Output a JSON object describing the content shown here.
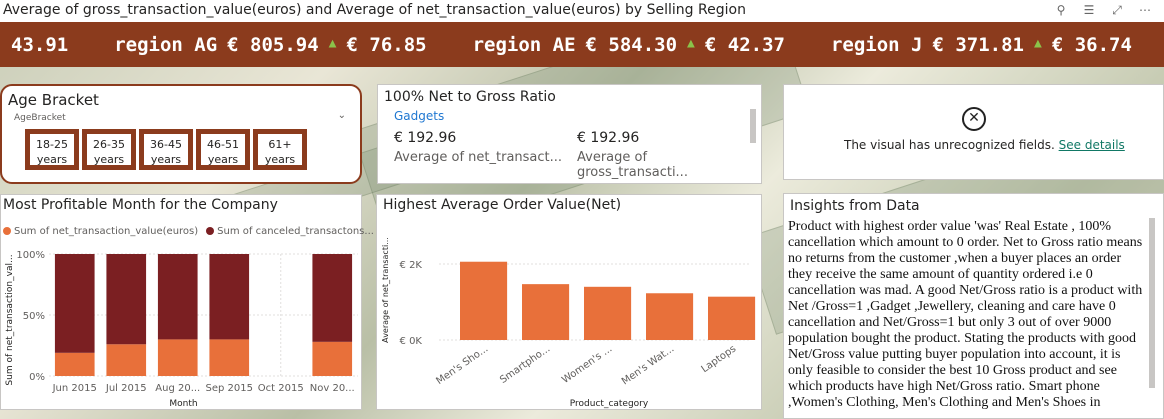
{
  "header": {
    "title": "Average of gross_transaction_value(euros) and Average of net_transaction_value(euros) by Selling Region"
  },
  "ticker": {
    "lead": "43.91",
    "items": [
      {
        "region": "region AG",
        "gross": "€ 805.94",
        "net": "€ 76.85"
      },
      {
        "region": "region AE",
        "gross": "€ 584.30",
        "net": "€ 42.37"
      },
      {
        "region": "region J",
        "gross": "€ 371.81",
        "net": "€ 36.74"
      }
    ],
    "up_color": "#8bc34a"
  },
  "age_slicer": {
    "title": "Age Bracket",
    "field_label": "AgeBracket",
    "options": [
      "18-25 years",
      "26-35 years",
      "36-45 years",
      "46-51 years",
      "61+ years"
    ]
  },
  "ratio_card": {
    "title": "100% Net to Gross Ratio",
    "tab": "Gadgets",
    "net_value": "€ 192.96",
    "net_label": "Average of net_transact...",
    "gross_value": "€ 192.96",
    "gross_label": "Average of gross_transacti..."
  },
  "error_visual": {
    "message": "The visual has unrecognized fields.",
    "link": "See details"
  },
  "month_chart": {
    "title": "Most Profitable Month for the Company",
    "legend": [
      "Sum of net_transaction_value(euros)",
      "Sum of canceled_transactons..."
    ],
    "colors": [
      "#e8703a",
      "#7b1f22"
    ]
  },
  "aov_chart": {
    "title": "Highest Average Order Value(Net)",
    "color": "#e8703a"
  },
  "insights": {
    "title": "Insights from Data",
    "text": "Product with highest order value 'was' Real Estate , 100% cancellation which amount to 0 order. Net to Gross ratio means no returns from the customer ,when a buyer places an order they receive the same amount of quantity ordered i.e 0 cancellation was mad. A good Net/Gross ratio is a product with Net /Gross=1 ,Gadget ,Jewellery, cleaning and care have 0 cancellation and Net/Gross=1 but only 3 out of over 9000 population bought the product. Stating the products with good Net/Gross value putting buyer population into account, it is only feasible to consider the best 10 Gross product and see which products have high Net/Gross ratio. Smart phone ,Women's Clothing, Men's Clothing and Men's Shoes in"
  },
  "chart_data": [
    {
      "type": "bar",
      "stacked": "100%",
      "title": "Most Profitable Month for the Company",
      "xlabel": "Month",
      "ylabel": "Sum of net_transaction_val...",
      "categories": [
        "Jun 2015",
        "Jul 2015",
        "Aug 20...",
        "Sep 2015",
        "Oct 2015",
        "Nov 20..."
      ],
      "series": [
        {
          "name": "Sum of net_transaction_value(euros)",
          "values": [
            19,
            26,
            30,
            30,
            0,
            28
          ]
        },
        {
          "name": "Sum of canceled_transactons...",
          "values": [
            81,
            74,
            70,
            70,
            0,
            72
          ]
        }
      ],
      "yticks": [
        "0%",
        "50%",
        "100%"
      ],
      "ylim": [
        0,
        100
      ]
    },
    {
      "type": "bar",
      "title": "Highest Average Order Value(Net)",
      "xlabel": "Product_category",
      "ylabel": "Average of net_transacti...",
      "categories": [
        "Men's Sho...",
        "Smartpho...",
        "Women's ...",
        "Men's Wat...",
        "Laptops"
      ],
      "values": [
        2060,
        1470,
        1400,
        1230,
        1140
      ],
      "yticks": [
        "€ 0K",
        "€ 2K"
      ],
      "ylim": [
        0,
        2200
      ]
    }
  ]
}
